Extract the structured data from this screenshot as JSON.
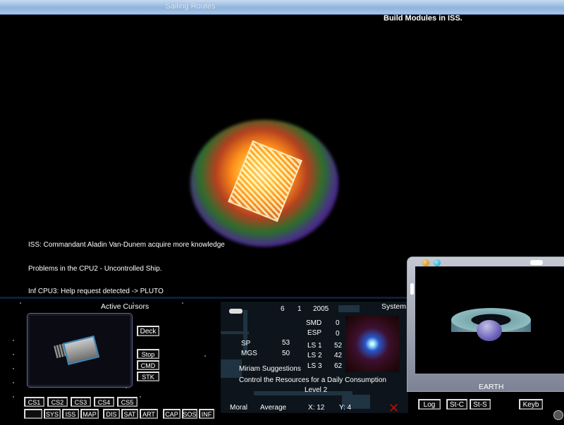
{
  "window": {
    "title": "Sailing Routes"
  },
  "top_message": "Build Modules in ISS.",
  "messages": [
    "ISS: Commandant Aladin Van-Dunem acquire more knowledge",
    "Problems in the CPU2 - Uncontrolled Ship.",
    "Inf CPU3: Help request detected -> PLUTO"
  ],
  "cursors_panel": {
    "title": "Active Cursors",
    "buttons": {
      "deck": "Deck",
      "stop": "Stop",
      "cmd": "CMD",
      "stk": "STK"
    },
    "cs_buttons": [
      "CS1",
      "CS2",
      "CS3",
      "CS4",
      "CS5"
    ],
    "bottom_buttons": [
      "",
      "SYS",
      "ISS",
      "MAP",
      "DIS",
      "SAT",
      "ART",
      "CAP",
      "SOS",
      "INF"
    ]
  },
  "status": {
    "date": {
      "day": "6",
      "month": "1",
      "year": "2005"
    },
    "smd_label": "SMD",
    "smd_value": "0",
    "esp_label": "ESP",
    "esp_value": "0",
    "sp_label": "SP",
    "sp_value": "53",
    "mgs_label": "MGS",
    "mgs_value": "50",
    "ls1_label": "LS 1",
    "ls1_value": "52",
    "ls2_label": "LS 2",
    "ls2_value": "42",
    "ls3_label": "LS 3",
    "ls3_value": "62",
    "suggestion_title": "Miriam Suggestions",
    "suggestion_text": "Control the Resources for a Daily Consumption",
    "level": "Level 2",
    "moral_label": "Moral",
    "moral_value": "Average",
    "x_coord": "X: 12",
    "y_coord": "Y: 4"
  },
  "system_label": "System",
  "earth_panel": {
    "label": "EARTH",
    "buttons": {
      "log": "Log",
      "stc": "St-C",
      "sts": "St-S",
      "keyb": "Keyb"
    }
  },
  "colors": {
    "title_bar": "#a9c6e6",
    "panel_bg": "#000000",
    "alert_x": "#b21010"
  }
}
